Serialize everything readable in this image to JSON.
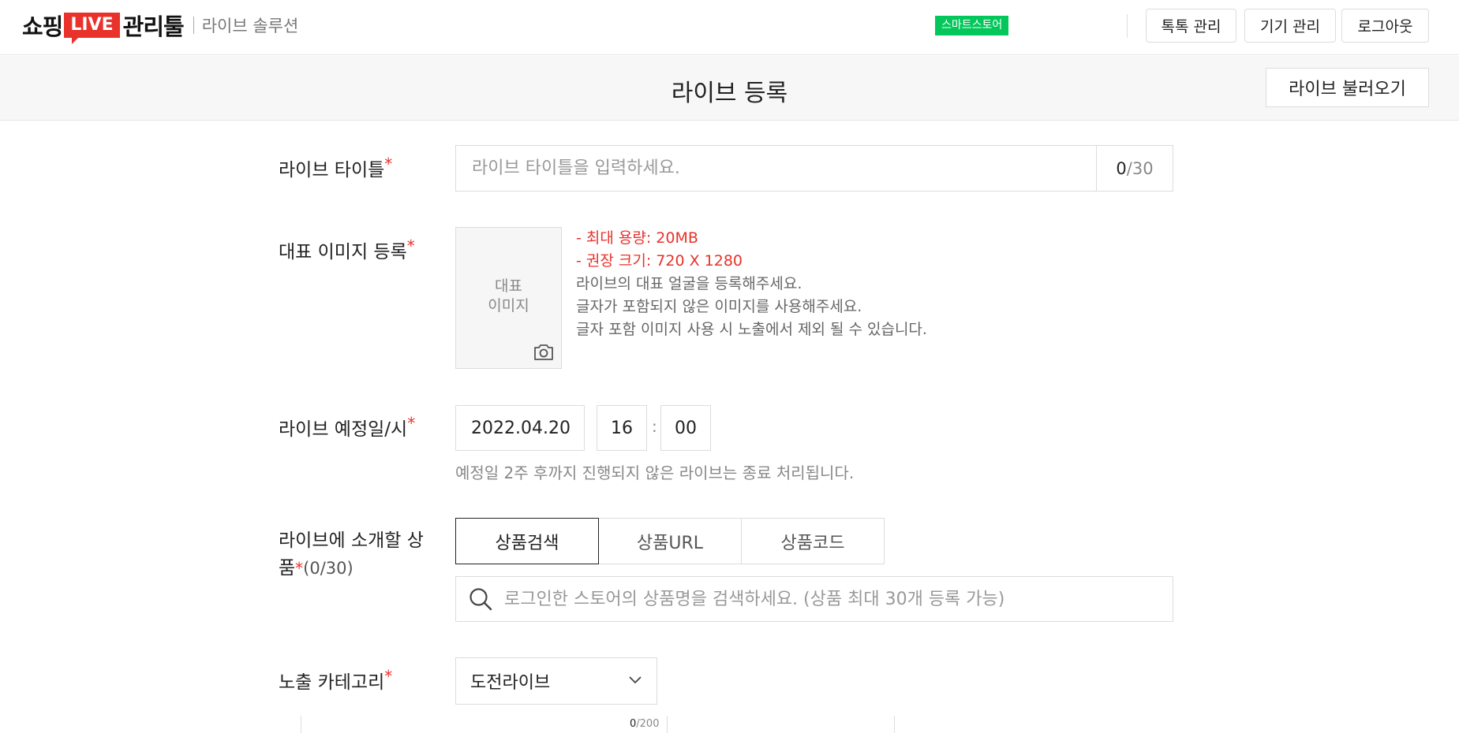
{
  "header": {
    "logo": {
      "part1": "쇼핑",
      "live": "LIVE",
      "part2": "관리툴",
      "sub": "라이브 솔루션"
    },
    "store_badge": "스마트스토어",
    "buttons": {
      "talk": "톡톡 관리",
      "device": "기기 관리",
      "logout": "로그아웃"
    }
  },
  "titlebar": {
    "title": "라이브 등록",
    "load_button": "라이브 불러오기"
  },
  "form": {
    "title": {
      "label": "라이브 타이틀",
      "placeholder": "라이브 타이틀을 입력하세요.",
      "count_current": "0",
      "count_max": "/30"
    },
    "image": {
      "label": "대표 이미지 등록",
      "box_text": "대표\n이미지",
      "info_red_1": "- 최대 용량: 20MB",
      "info_red_2": "- 권장 크기: 720 X 1280",
      "info_1": "라이브의 대표 얼굴을 등록해주세요.",
      "info_2": "글자가 포함되지 않은 이미지를 사용해주세요.",
      "info_3": "글자 포함 이미지 사용 시 노출에서 제외 될 수 있습니다."
    },
    "schedule": {
      "label": "라이브 예정일/시",
      "date": "2022.04.20",
      "hour": "16",
      "colon": ":",
      "minute": "00",
      "note": "예정일 2주 후까지 진행되지 않은 라이브는 종료 처리됩니다."
    },
    "products": {
      "label_line1": "라이브에 소개할 상",
      "label_line2": "품",
      "count": "(0/30)",
      "tabs": [
        "상품검색",
        "상품URL",
        "상품코드"
      ],
      "search_placeholder": "로그인한 스토어의 상품명을 검색하세요. (상품 최대 30개 등록 가능)"
    },
    "category": {
      "label": "노출 카테고리",
      "selected": "도전라이브"
    },
    "bottom_counter": {
      "current": "0",
      "max": "/200"
    }
  },
  "colors": {
    "accent_red": "#e8322b",
    "store_green": "#03c75a"
  }
}
